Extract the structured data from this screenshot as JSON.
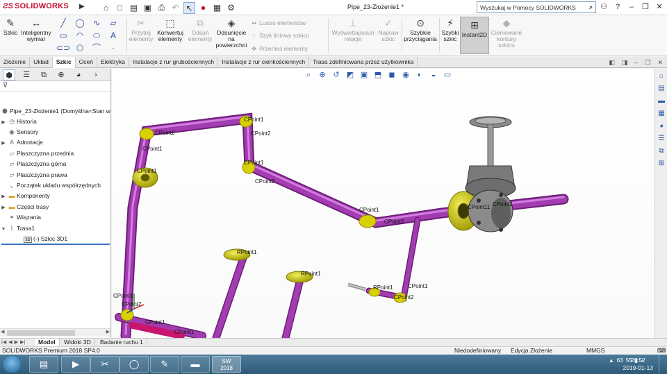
{
  "titlebar": {
    "app_name": "SOLIDWORKS",
    "doc_title": "Pipe_23-Złożenie1 *",
    "search_placeholder": "Wyszukaj w Pomocy SOLIDWORKS",
    "help_symbol": "?",
    "brand_color": "#c8102e"
  },
  "ribbon": {
    "szkic": "Szkic",
    "inteligentny_wymiar": "Inteligentny wymiar",
    "przytnij": "Przytnij elementy",
    "konwertuj": "Konwertuj elementy",
    "odsun": "Odsuń elementy",
    "odsuniecie": "Odsunięcie na powierzchni",
    "lustro": "Lustro elementów",
    "szyk_liniowy": "Szyk liniowy szkicu",
    "przenies": "Przenieś elementy",
    "wyswietlaj": "Wyświetlaj/usuń relacje",
    "napraw": "Napraw szkic",
    "szybkie_przyciaganie": "Szybkie przyciągania",
    "szybki_szkic": "Szybki szkic",
    "instant2d": "Instant2D",
    "cieniowane": "Cieniowane kontury szkicu"
  },
  "tabs": [
    {
      "label": "Złożenie",
      "active": false
    },
    {
      "label": "Układ",
      "active": false
    },
    {
      "label": "Szkic",
      "active": true
    },
    {
      "label": "Oceń",
      "active": false
    },
    {
      "label": "Elektryka",
      "active": false
    },
    {
      "label": "Instalacje z rur grubościennych",
      "active": false
    },
    {
      "label": "Instalacje z rur cienkościennych",
      "active": false
    },
    {
      "label": "Trasa zdefiniowana przez użytkownika",
      "active": false
    }
  ],
  "tree": {
    "root": "Pipe_23-Złożenie1  (Domyślna<Stan w",
    "items": [
      {
        "label": "Historia"
      },
      {
        "label": "Sensory"
      },
      {
        "label": "Adnotacje"
      },
      {
        "label": "Płaszczyzna przednia"
      },
      {
        "label": "Płaszczyzna górna"
      },
      {
        "label": "Płaszczyzna prawa"
      },
      {
        "label": "Początek układu współrzędnych"
      },
      {
        "label": "Komponenty"
      },
      {
        "label": "Części trasy"
      },
      {
        "label": "Wiązania"
      },
      {
        "label": "Trasa1"
      },
      {
        "label": "(-) Szkic 3D1"
      }
    ]
  },
  "viewport": {
    "labels": {
      "p1": "CPoint1",
      "p2": "CPoint2",
      "p3": "RPoint1",
      "p4": "CPoint11"
    },
    "colors": {
      "pipe": "#a33cb0",
      "fitting": "#d8d000",
      "flange": "#c9c400",
      "valve": "#7a7a7a"
    }
  },
  "bottom_tabs": [
    {
      "label": "Model",
      "active": true
    },
    {
      "label": "Widoki 3D",
      "active": false
    },
    {
      "label": "Badanie ruchu 1",
      "active": false
    }
  ],
  "status": {
    "version": "SOLIDWORKS Premium 2018 SP4.0",
    "definition": "Niedodefiniowany",
    "mode": "Edycja Złożenie",
    "units": "MMGS"
  },
  "taskbar": {
    "sw_year": "2018",
    "tray_a": "63",
    "tray_b": "55",
    "time": "20:52",
    "date": "2019-01-13"
  }
}
